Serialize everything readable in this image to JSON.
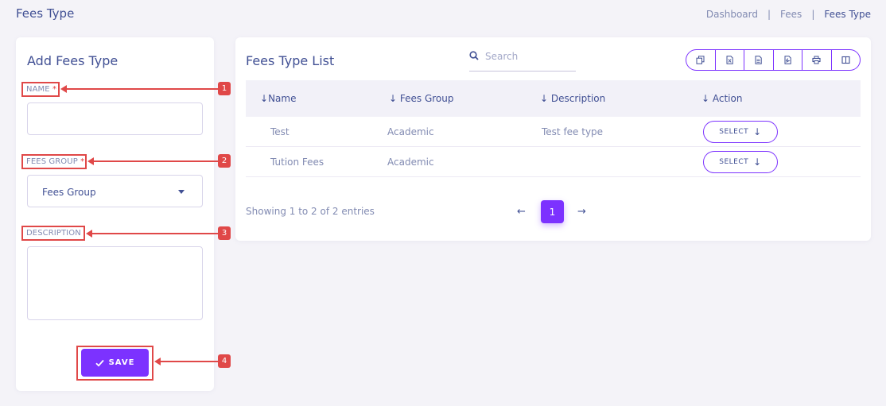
{
  "header": {
    "title": "Fees Type",
    "breadcrumb": [
      "Dashboard",
      "Fees",
      "Fees Type"
    ],
    "breadcrumb_sep": "|"
  },
  "form": {
    "title": "Add Fees Type",
    "name_label": "NAME",
    "name_value": "",
    "fees_group_label": "FEES GROUP",
    "fees_group_selected": "Fees Group",
    "description_label": "DESCRIPTION",
    "description_value": "",
    "required_mark": "*",
    "save_label": "SAVE"
  },
  "annotations": [
    "1",
    "2",
    "3",
    "4"
  ],
  "list": {
    "title": "Fees Type List",
    "search_placeholder": "Search",
    "export_icons": [
      "copy-icon",
      "excel-icon",
      "csv-icon",
      "pdf-icon",
      "print-icon",
      "columns-icon"
    ],
    "columns": [
      "Name",
      "Fees Group",
      "Description",
      "Action"
    ],
    "rows": [
      {
        "name": "Test",
        "fees_group": "Academic",
        "description": "Test fee type",
        "action": "SELECT"
      },
      {
        "name": "Tution Fees",
        "fees_group": "Academic",
        "description": "",
        "action": "SELECT"
      }
    ],
    "showing": "Showing 1 to 2 of 2 entries",
    "current_page": "1"
  },
  "colors": {
    "accent": "#7c32ff",
    "annotation": "#e04848",
    "text": "#415094",
    "muted": "#828bb2"
  }
}
